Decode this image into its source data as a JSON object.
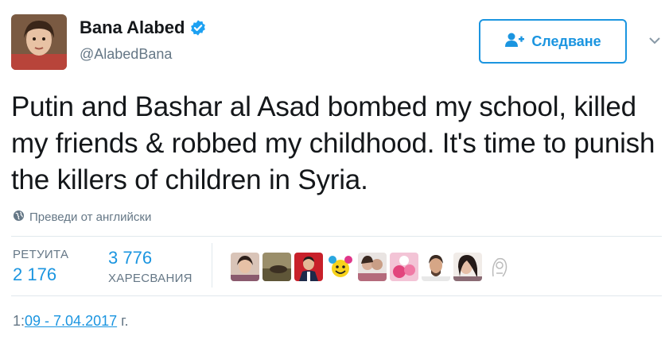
{
  "user": {
    "name": "Bana Alabed",
    "handle": "@AlabedBana",
    "verified": true
  },
  "follow_button": {
    "label": "Следване",
    "icon": "follow-user-icon"
  },
  "tweet": {
    "text": "Putin and Bashar al Asad bombed my school, killed my friends & robbed my childhood. It's time to punish the killers of children in Syria.",
    "translate_label": "Преведи от английски"
  },
  "stats": {
    "retweets_label": "РЕТУИТА",
    "retweets_value": "2 176",
    "likes_value": "3 776",
    "likes_label": "ХАРЕСВАНИЯ"
  },
  "likers": [
    {
      "name": "liker-avatar-1"
    },
    {
      "name": "liker-avatar-2"
    },
    {
      "name": "liker-avatar-3"
    },
    {
      "name": "liker-avatar-4"
    },
    {
      "name": "liker-avatar-5"
    },
    {
      "name": "liker-avatar-6"
    },
    {
      "name": "liker-avatar-7"
    },
    {
      "name": "liker-avatar-8"
    },
    {
      "name": "liker-avatar-9"
    }
  ],
  "timestamp": {
    "prefix": "1:",
    "link": "09 - 7.04.2017",
    "suffix": " г."
  },
  "colors": {
    "accent": "#1b95e0",
    "text": "#14171a",
    "muted": "#657786",
    "divider": "#e1e8ed"
  }
}
